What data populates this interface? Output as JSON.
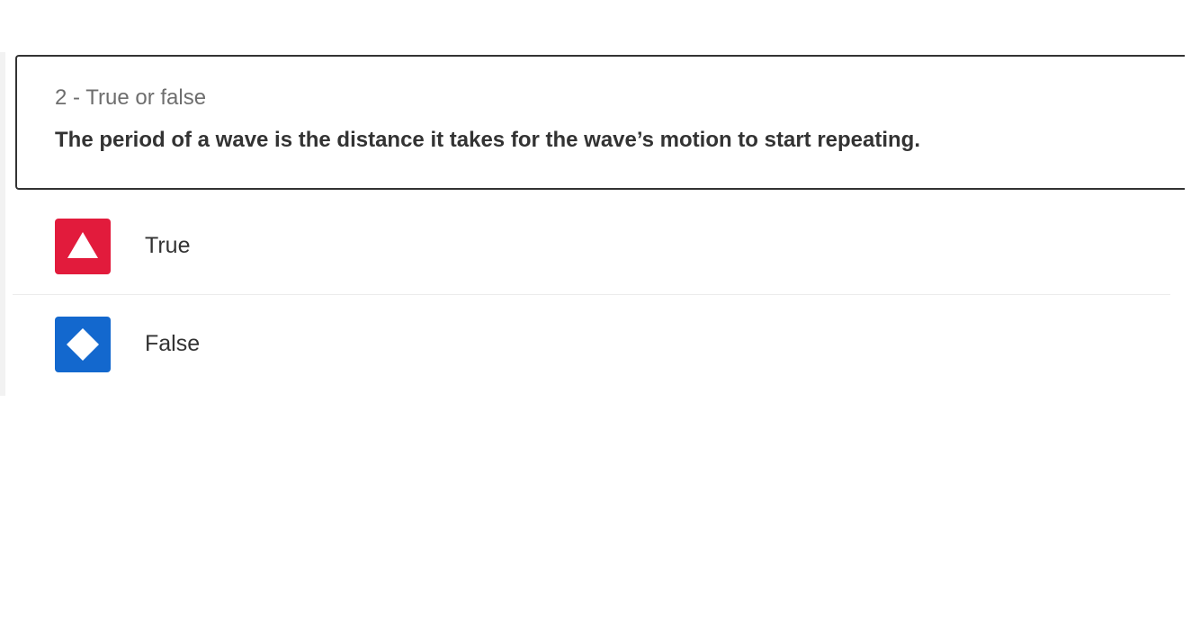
{
  "question": {
    "label": "2 - True or false",
    "text": "The period of a wave is the distance it takes for the wave’s motion to start repeating."
  },
  "answers": [
    {
      "label": "True",
      "icon": "triangle-icon",
      "color": "#e21b3c"
    },
    {
      "label": "False",
      "icon": "diamond-icon",
      "color": "#1368ce"
    }
  ]
}
